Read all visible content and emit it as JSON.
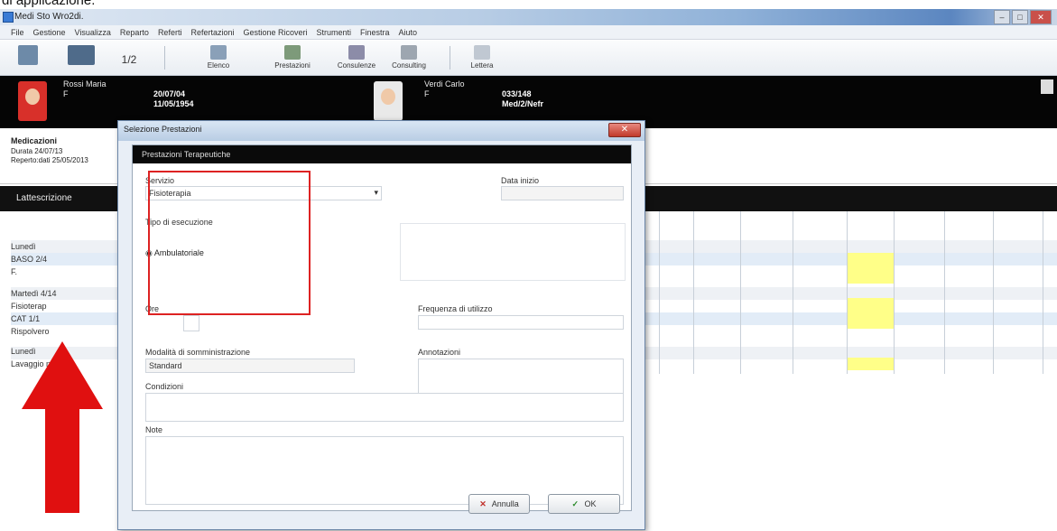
{
  "caption": "di applicazione.",
  "window": {
    "title": "Medi Sto Wro2di.",
    "controls": [
      "–",
      "□",
      "✕"
    ]
  },
  "menu": [
    "File",
    "Gestione",
    "Visualizza",
    "Reparto",
    "Referti",
    "Refertazioni",
    "Gestione Ricoveri",
    "Strumenti",
    "Finestra",
    "Aiuto"
  ],
  "toolbar": {
    "page_indicator": "1/2",
    "buttons": [
      "Elenco",
      "Prestazioni",
      "Consulenze",
      "Consulting",
      "Lettera"
    ]
  },
  "patients": [
    {
      "name": "Rossi Maria",
      "row1": "F",
      "row2": "20/07/04",
      "row3": "11/05/1954"
    },
    {
      "name": "Verdi Carlo",
      "row1": "F",
      "row2": "033/148",
      "row3": "Med/2/Nefr"
    }
  ],
  "medications": {
    "title": "Medicazioni",
    "line1": "Durata   24/07/13",
    "line2": "Reperto:dati  25/05/2013"
  },
  "section_label": "Lattescrizione",
  "grid_rows": [
    "Lunedì",
    "BASO 2/4",
    "F.",
    "Martedì 4/14",
    "Fisioterap",
    "CAT 1/1",
    "Rispolvero",
    "Lunedì",
    "Lavaggio nasale"
  ],
  "dialog": {
    "title": "Selezione Prestazioni",
    "header": "Prestazioni Terapeutiche",
    "close_label": "✕",
    "fields": {
      "servizio_label": "Servizio",
      "servizio_value": "Fisioterapia",
      "tipo_label": "Tipo di esecuzione",
      "radio_label": "Ambulatoriale",
      "data_inizio_label": "Data inizio",
      "ore_label": "Ore",
      "frequenza_label": "Frequenza di utilizzo",
      "modalita_label": "Modalità di somministrazione",
      "modalita_value": "Standard",
      "annotazioni_label": "Annotazioni",
      "condizioni_label": "Condizioni",
      "note_label": "Note"
    },
    "buttons": {
      "cancel": "Annulla",
      "ok": "OK"
    }
  },
  "colors": {
    "highlight": "#ffff88",
    "red": "#e01010",
    "black_bar": "#050505"
  }
}
